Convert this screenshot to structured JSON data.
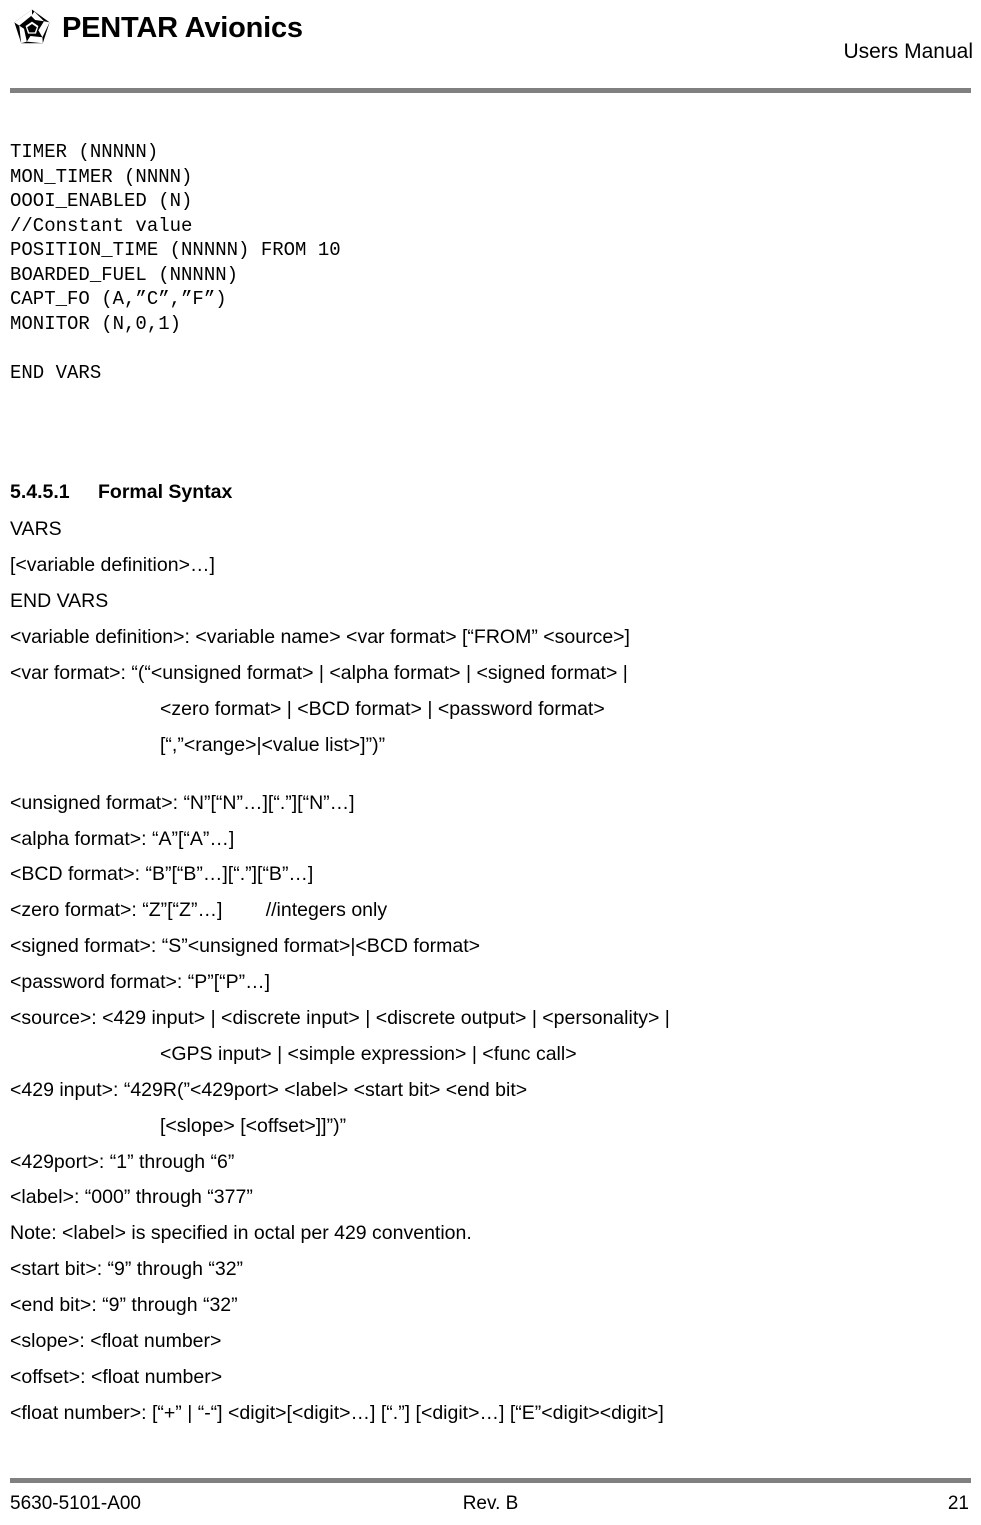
{
  "header": {
    "company": "PENTAR Avionics",
    "logo_icon": "pentar-shutter-logo-icon",
    "document_title": "Users Manual"
  },
  "footer": {
    "doc_number": "5630-5101-A00",
    "revision": "Rev. B",
    "page_number": "21"
  },
  "colors": {
    "rule": "#808080",
    "text": "#000000",
    "background": "#ffffff"
  },
  "code_block": {
    "lines": [
      "TIMER (NNNNN)",
      "MON_TIMER (NNNN)",
      "OOOI_ENABLED (N)",
      "//Constant value",
      "POSITION_TIME (NNNNN) FROM 10",
      "BOARDED_FUEL (NNNNN)",
      "CAPT_FO (A,”C”,”F”)",
      "MONITOR (N,0,1)",
      "",
      "END VARS"
    ]
  },
  "section": {
    "number": "5.4.5.1",
    "title": "Formal Syntax"
  },
  "syntax": {
    "lines": [
      {
        "text": "VARS",
        "indent": false
      },
      {
        "text": "[<variable definition>…]",
        "indent": false
      },
      {
        "text": "END VARS",
        "indent": false
      },
      {
        "text": "<variable definition>: <variable name> <var format> [“FROM” <source>]",
        "indent": false
      },
      {
        "text": "<var format>: “(“<unsigned format> | <alpha format> | <signed format> |",
        "indent": false
      },
      {
        "text": "<zero format> | <BCD format> | <password format>",
        "indent": true
      },
      {
        "text": "[“,”<range>|<value list>]”)”",
        "indent": true
      },
      {
        "text": "",
        "indent": false
      },
      {
        "text": "<unsigned format>: “N”[“N”…][“.”][“N”…]",
        "indent": false
      },
      {
        "text": "<alpha format>: “A”[“A”…]",
        "indent": false
      },
      {
        "text": "<BCD format>: “B”[“B”…][“.”][“B”…]",
        "indent": false
      },
      {
        "text": "<zero format>: “Z”[“Z”…]        //integers only",
        "indent": false
      },
      {
        "text": "<signed format>: “S”<unsigned format>|<BCD format>",
        "indent": false
      },
      {
        "text": "<password format>: “P”[“P”…]",
        "indent": false
      },
      {
        "text": "<source>: <429 input> | <discrete input> | <discrete output> | <personality> |",
        "indent": false
      },
      {
        "text": "<GPS input> | <simple expression> | <func call>",
        "indent": true
      },
      {
        "text": "<429 input>: “429R(”<429port> <label> <start bit> <end bit>",
        "indent": false
      },
      {
        "text": "[<slope> [<offset>]]”)”",
        "indent": true
      },
      {
        "text": "<429port>: “1” through “6”",
        "indent": false
      },
      {
        "text": "<label>: “000” through “377”",
        "indent": false
      },
      {
        "text": "Note: <label> is specified in octal per 429 convention.",
        "indent": false
      },
      {
        "text": "<start bit>: “9” through “32”",
        "indent": false
      },
      {
        "text": "<end bit>: “9” through “32”",
        "indent": false
      },
      {
        "text": "<slope>: <float number>",
        "indent": false
      },
      {
        "text": "<offset>: <float number>",
        "indent": false
      },
      {
        "text": "<float number>: [“+” | “-“] <digit>[<digit>…] [“.”] [<digit>…] [“E”<digit><digit>]",
        "indent": false
      }
    ]
  }
}
